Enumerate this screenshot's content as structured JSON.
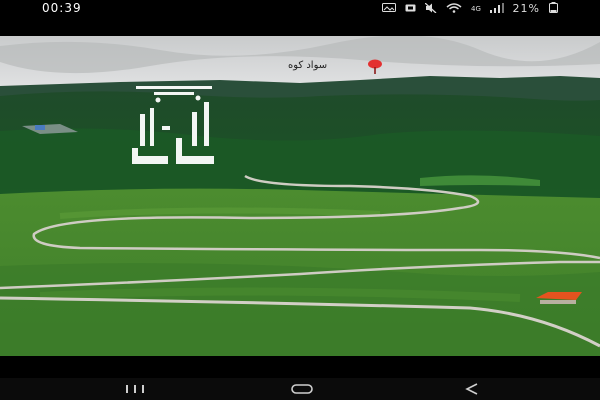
{
  "status_bar": {
    "time": "00:39",
    "battery_percent": "21%",
    "icons": [
      "photo-icon",
      "alarm-icon",
      "mute-icon",
      "wifi-icon",
      "lte-icon",
      "signal-icon",
      "battery-icon"
    ]
  },
  "photo": {
    "location_label": "سواد کوه",
    "watermark_text": "زمین باز",
    "colors": {
      "sky": "#d8dadb",
      "mountains": "#1f4a2a",
      "forest": "#1e5527",
      "meadow": "#5a9a36",
      "road": "#c9c6bd",
      "roof": "#e4531f",
      "pin": "#e33030"
    }
  },
  "nav_bar": {
    "buttons": [
      "recents-button",
      "home-button",
      "back-button"
    ]
  }
}
